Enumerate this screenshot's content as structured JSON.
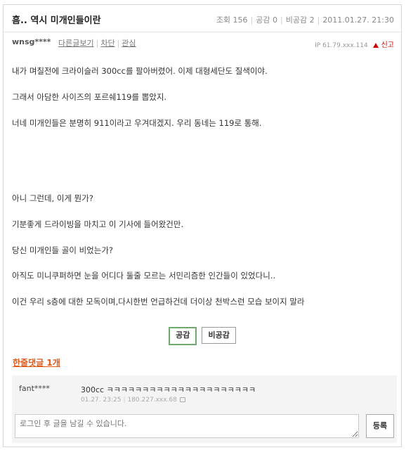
{
  "post": {
    "title": "흠.. 역시 미개인들이란",
    "views_label": "조회 156",
    "like_label": "공감 0",
    "dislike_label": "비공감 2",
    "date": "2011.01.27. 21:30",
    "author": "wnsg****",
    "author_links": [
      "다른글보기",
      "차단",
      "관심"
    ],
    "ip": "IP 61.79.xxx.114",
    "report_label": "신고",
    "body": [
      "내가 며칠전에 크라이슬러 300cc를 팔아버렸어. 이제 대형세단도 질색이야.",
      "그래서 아담한 사이즈의 포르쉐119를 뽑았지.",
      "너네 미개인들은 분명히 911이라고 우겨대겠지. 우리 동네는 119로 통해.",
      "아니 그런데, 이게 뭔가?",
      "기분좋게 드라이빙을 마치고 이 기사에 들어왔건만.",
      "당신 미개인들 골이 비었는가?",
      "아직도 미니쿠퍼하면 눈을 어디다 둘줄 모르는 서민리즘한 인간들이 있었다니..",
      "이건 우리 s층에 대한 모독이며,다시한번 언급하건데 더이상 천박스런 모습 보이지 말라"
    ],
    "like_button": "공감",
    "dislike_button": "비공감"
  },
  "comments": {
    "header": "한줄댓글 1개",
    "items": [
      {
        "author": "fant****",
        "text": "300cc ㅋㅋㅋㅋㅋㅋㅋㅋㅋㅋㅋㅋㅋㅋㅋㅋㅋㅋㅋㅋㅋ",
        "date": "01.27. 23:25",
        "ip": "180.227.xxx.68"
      }
    ],
    "input_placeholder": "로그인 후 글을 남길 수 있습니다.",
    "submit_label": "등록"
  },
  "colors": {
    "accent": "#e05a1a",
    "like_border": "#6ea96e",
    "report": "#cc0000"
  },
  "icons": [
    "report-icon",
    "lock-icon"
  ]
}
